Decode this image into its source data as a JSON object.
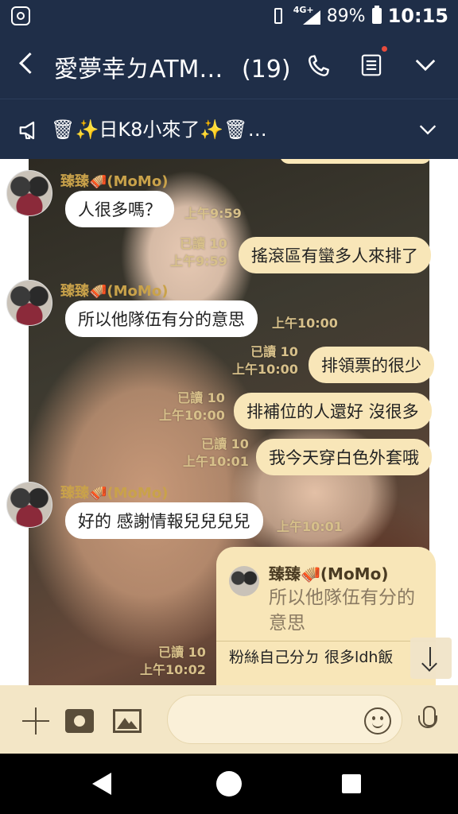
{
  "status": {
    "network": "4G+",
    "battery": "89%",
    "time": "10:15"
  },
  "header": {
    "title": "愛夢幸ㄉATM…",
    "count": "(19)"
  },
  "announcement": {
    "text": "🗑✨日K8小來了✨🗑…"
  },
  "messages": [
    {
      "side": "left",
      "sender": "臻臻🪗(MoMo)",
      "text": "人很多嗎？",
      "time": "上午9:59"
    },
    {
      "side": "right",
      "read": "已讀 10",
      "text": "搖滾區有蠻多人來排了",
      "time": "上午9:59"
    },
    {
      "side": "left",
      "sender": "臻臻🪗(MoMo)",
      "text": "所以他隊伍有分的意思",
      "time": "上午10:00"
    },
    {
      "side": "right",
      "read": "已讀 10",
      "text": "排領票的很少",
      "time": "上午10:00"
    },
    {
      "side": "right",
      "read": "已讀 10",
      "text": "排補位的人還好 沒很多",
      "time": "上午10:00"
    },
    {
      "side": "right",
      "read": "已讀 10",
      "text": "我今天穿白色外套哦",
      "time": "上午10:01"
    },
    {
      "side": "left",
      "sender": "臻臻🪗(MoMo)",
      "text": "好的 感謝情報兒兒兒兒",
      "time": "上午10:01"
    }
  ],
  "reply": {
    "quoted_sender": "臻臻🪗(MoMo)",
    "quoted_text": "所以他隊伍有分的意思",
    "text": "粉絲自己分ㄉ 很多ldh飯",
    "read": "已讀 10",
    "time": "上午10:02"
  },
  "colors": {
    "header_bg": "#1f2e48",
    "bubble_right": "#f8e6b8",
    "input_bg": "#f3e6c6"
  }
}
